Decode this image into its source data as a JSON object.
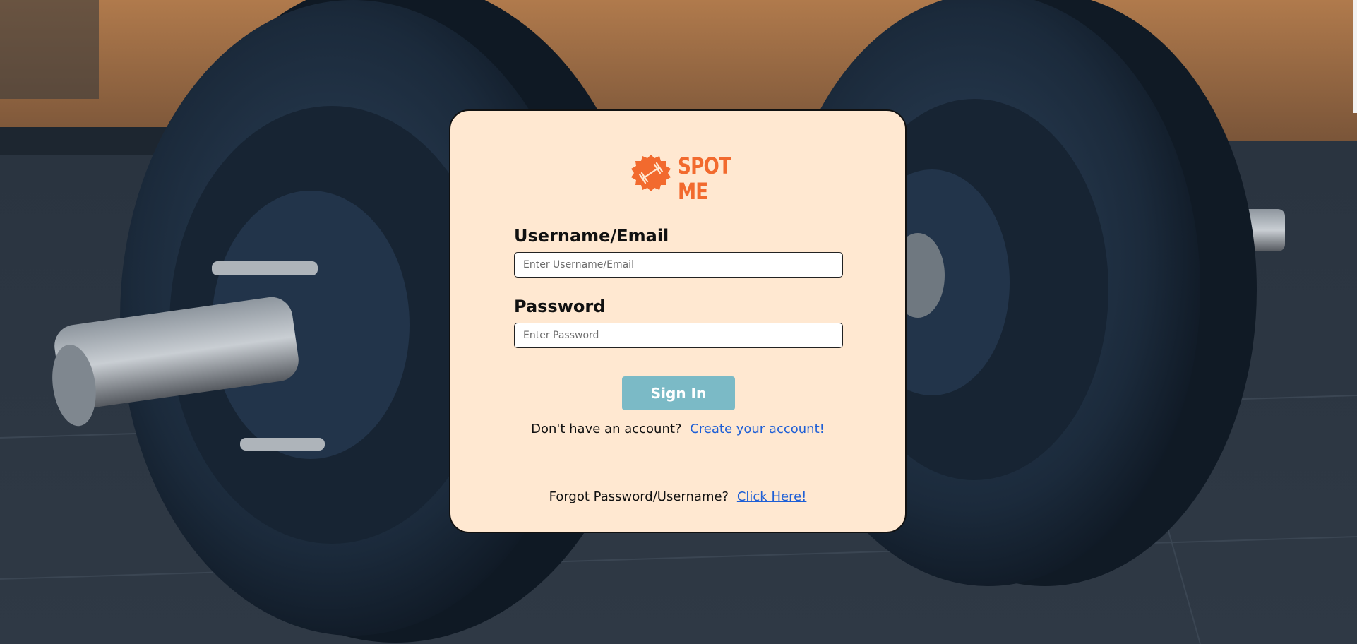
{
  "brand": {
    "name_line1": "SPOT",
    "name_line2": "ME",
    "logo_icon": "dumbbell-badge-icon",
    "color": "#f26a2e"
  },
  "form": {
    "username_label": "Username/Email",
    "username_placeholder": "Enter Username/Email",
    "username_value": "",
    "password_label": "Password",
    "password_placeholder": "Enter Password",
    "password_value": "",
    "signin_label": "Sign In",
    "signin_color": "#7bbac6"
  },
  "links": {
    "create_prompt": "Don't have an account?",
    "create_link": "Create your account!",
    "forgot_prompt": "Forgot Password/Username?",
    "forgot_link": "Click Here!",
    "link_color": "#1e5fd6"
  },
  "card": {
    "background": "#ffe8d1"
  }
}
